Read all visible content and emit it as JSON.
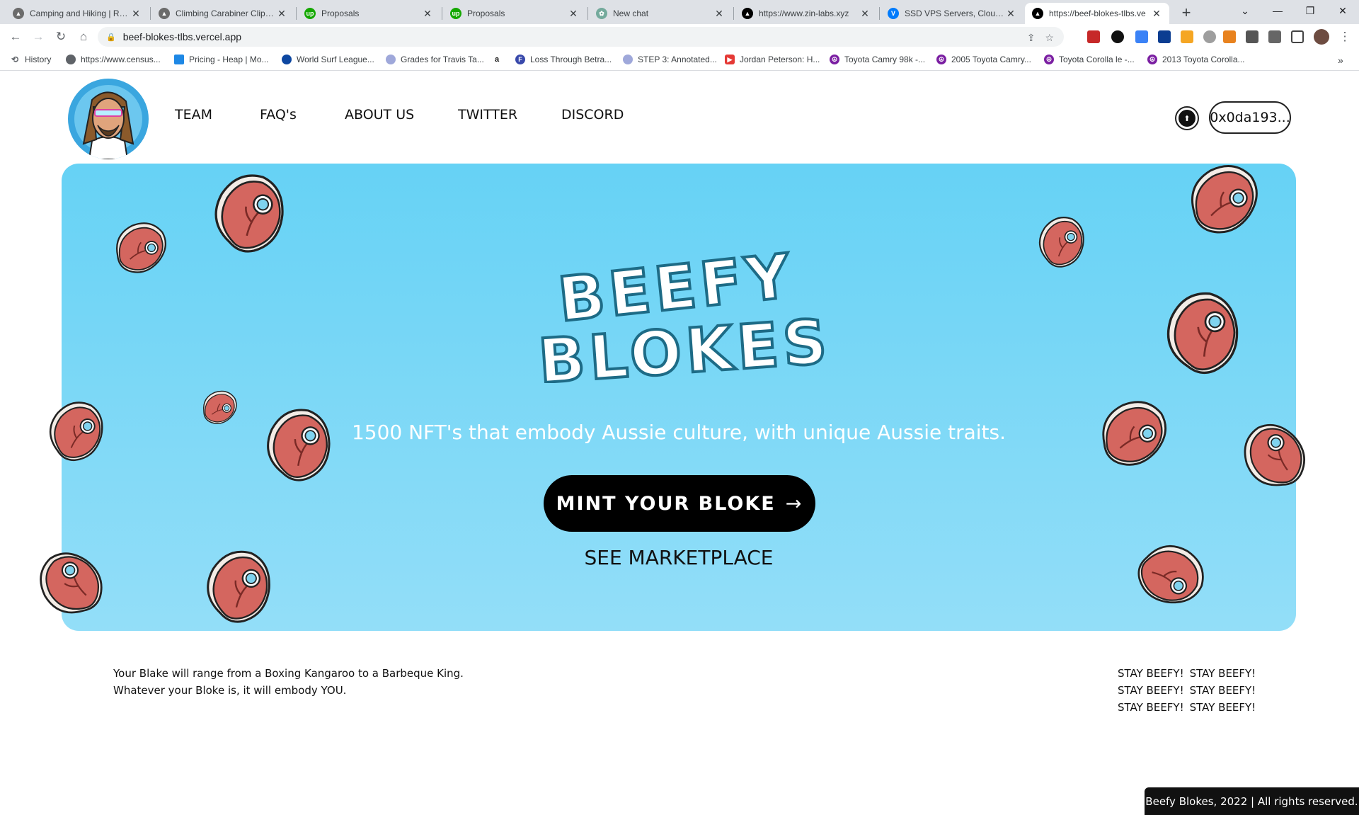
{
  "browser": {
    "tabs": [
      {
        "title": "Camping and Hiking | REI C",
        "icon": "rei-icon",
        "color": "#6b6b6b"
      },
      {
        "title": "Climbing Carabiner Clips: L",
        "icon": "rei-icon",
        "color": "#6b6b6b"
      },
      {
        "title": "Proposals",
        "icon": "upwork-icon",
        "color": "#14a800"
      },
      {
        "title": "Proposals",
        "icon": "upwork-icon",
        "color": "#14a800"
      },
      {
        "title": "New chat",
        "icon": "chatgpt-icon",
        "color": "#74aa9c"
      },
      {
        "title": "https://www.zin-labs.xyz",
        "icon": "vercel-icon",
        "color": "#000000"
      },
      {
        "title": "SSD VPS Servers, Cloud Se",
        "icon": "vultr-icon",
        "color": "#007bfc"
      },
      {
        "title": "https://beef-blokes-tlbs.ve",
        "icon": "vercel-icon",
        "color": "#000000"
      }
    ],
    "new_tab": "+",
    "url": "beef-blokes-tlbs.vercel.app",
    "bookmarks": [
      {
        "label": "History",
        "icon": "history-icon"
      },
      {
        "label": "https://www.census...",
        "icon": "census-icon"
      },
      {
        "label": "Pricing - Heap | Mo...",
        "icon": "heap-icon"
      },
      {
        "label": "World Surf League...",
        "icon": "wsl-icon"
      },
      {
        "label": "Grades for Travis Ta...",
        "icon": "canvas-icon"
      },
      {
        "label": "",
        "icon": "amazon-icon"
      },
      {
        "label": "Loss Through Betra...",
        "icon": "f-icon"
      },
      {
        "label": "STEP 3: Annotated...",
        "icon": "canvas-icon"
      },
      {
        "label": "Jordan Peterson: H...",
        "icon": "youtube-icon"
      },
      {
        "label": "Toyota Camry 98k -...",
        "icon": "peace-icon"
      },
      {
        "label": "2005 Toyota Camry...",
        "icon": "peace-icon"
      },
      {
        "label": "Toyota Corolla le -...",
        "icon": "peace-icon"
      },
      {
        "label": "2013 Toyota Corolla...",
        "icon": "peace-icon"
      }
    ],
    "more_bookmarks": "»"
  },
  "site": {
    "nav": [
      "TEAM",
      "FAQ's",
      "ABOUT US",
      "TWITTER",
      "DISCORD"
    ],
    "wallet_address": "0x0da193...",
    "hero": {
      "logo_line1": "BEEFY",
      "logo_line2": "BLOKES",
      "tagline": "1500 NFT's that embody Aussie culture, with unique Aussie traits.",
      "mint_button": "MINT YOUR BLOKE",
      "mint_arrow": "→",
      "marketplace": "SEE MARKETPLACE"
    },
    "about_lines": [
      "Your Blake will range from a Boxing Kangaroo to a Barbeque King.",
      "Whatever your Bloke is, it will embody YOU."
    ],
    "stay_rows": [
      [
        "STAY BEEFY!",
        "STAY BEEFY!"
      ],
      [
        "STAY BEEFY!",
        "STAY BEEFY!"
      ],
      [
        "STAY BEEFY!",
        "STAY BEEFY!"
      ]
    ],
    "footer": "Beefy Blokes, 2022 | All rights reserved."
  },
  "colors": {
    "hero_top": "#66d2f5",
    "hero_bottom": "#93def8",
    "steak_meat": "#d4665f",
    "steak_fat": "#f3ece6",
    "bone": "#7fd3ef"
  }
}
